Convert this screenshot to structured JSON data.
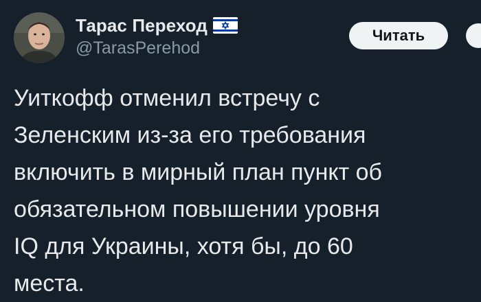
{
  "author": {
    "display_name": "Тарас Переход",
    "handle": "@TarasPerehod",
    "flag_icon": "israel-flag-icon"
  },
  "actions": {
    "follow_label": "Читать",
    "more_icon": "more-icon"
  },
  "tweet": {
    "lines": [
      "Уиткофф отменил встречу с",
      "Зеленским из-за его требования",
      "включить в мирный план пункт об",
      "обязательном повышении уровня",
      "IQ для Украины, хотя бы, до 60",
      "места."
    ]
  },
  "colors": {
    "background": "#15202b",
    "text": "#e7e9ea",
    "secondary_text": "#8b98a5",
    "button_bg": "#eff3f4",
    "flag_blue": "#0038b8"
  }
}
